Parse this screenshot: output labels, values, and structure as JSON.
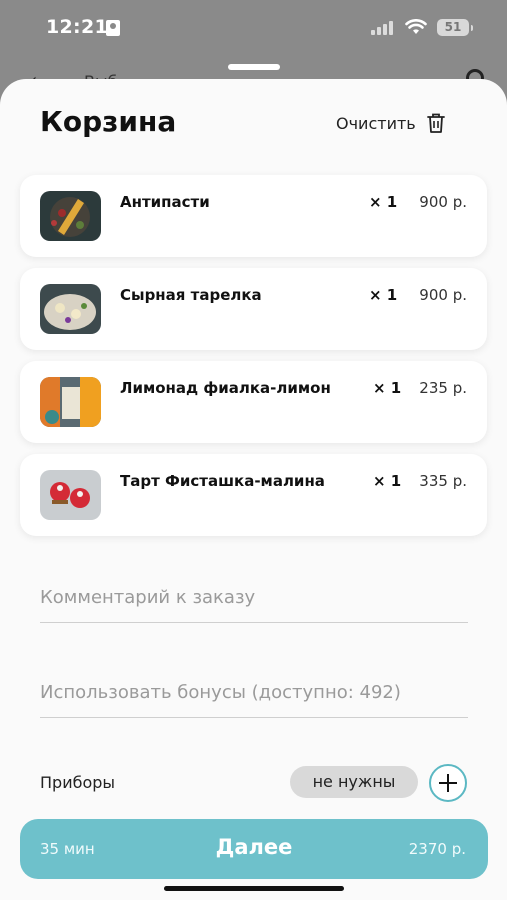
{
  "status_bar": {
    "time": "12:21",
    "battery": "51"
  },
  "background": {
    "back_text": "Выб"
  },
  "cart": {
    "title": "Корзина",
    "clear_label": "Очистить",
    "items": [
      {
        "name": "Антипасти",
        "qty": "× 1",
        "price": "900 р."
      },
      {
        "name": "Сырная тарелка",
        "qty": "× 1",
        "price": "900 р."
      },
      {
        "name": "Лимонад фиалка-лимон",
        "qty": "× 1",
        "price": "235 р."
      },
      {
        "name": "Тарт Фисташка-малина",
        "qty": "× 1",
        "price": "335 р."
      }
    ]
  },
  "form": {
    "comment_placeholder": "Комментарий к заказу",
    "bonus_placeholder": "Использовать бонусы (доступно: 492)",
    "cutlery_label": "Приборы",
    "cutlery_value": "не нужны"
  },
  "footer": {
    "time": "35 мин",
    "next_label": "Далее",
    "total": "2370 р."
  },
  "colors": {
    "accent": "#6ec1cb",
    "accent_border": "#5bb8c3",
    "pill": "#d9d9d9"
  }
}
